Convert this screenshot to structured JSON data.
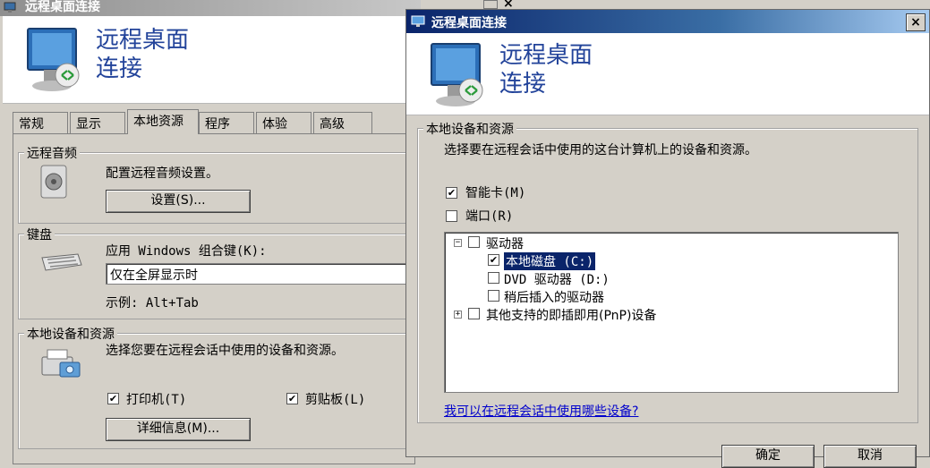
{
  "back_window": {
    "title": "远程桌面连接",
    "banner": {
      "line1": "远程桌面",
      "line2": "连接"
    },
    "tabs": [
      {
        "label": "常规"
      },
      {
        "label": "显示"
      },
      {
        "label": "本地资源"
      },
      {
        "label": "程序"
      },
      {
        "label": "体验"
      },
      {
        "label": "高级"
      }
    ],
    "audio": {
      "group_label": "远程音频",
      "description": "配置远程音频设置。",
      "settings_button": "设置(S)..."
    },
    "keyboard": {
      "group_label": "键盘",
      "apply_label": "应用 Windows 组合键(K):",
      "combo_value": "仅在全屏显示时",
      "example": "示例: Alt+Tab"
    },
    "local": {
      "group_label": "本地设备和资源",
      "description": "选择您要在远程会话中使用的设备和资源。",
      "printer_label": "打印机(T)",
      "printer_checked": true,
      "clipboard_label": "剪贴板(L)",
      "clipboard_checked": true,
      "more_button": "详细信息(M)..."
    }
  },
  "dialog": {
    "title": "远程桌面连接",
    "close_glyph": "×",
    "banner": {
      "line1": "远程桌面",
      "line2": "连接"
    },
    "group_label": "本地设备和资源",
    "description": "选择要在远程会话中使用的这台计算机上的设备和资源。",
    "smart_card": {
      "label": "智能卡(M)",
      "checked": true
    },
    "ports": {
      "label": "端口(R)",
      "checked": false
    },
    "tree": {
      "drives": {
        "label": "驱动器",
        "expander": "−",
        "checked": false,
        "children": [
          {
            "label": "本地磁盘 (C:)",
            "checked": true,
            "selected": true
          },
          {
            "label": "DVD 驱动器 (D:)",
            "checked": false
          },
          {
            "label": "稍后插入的驱动器",
            "checked": false
          }
        ]
      },
      "pnp": {
        "label": "其他支持的即插即用(PnP)设备",
        "expander": "+",
        "checked": false
      }
    },
    "help_link": "我可以在远程会话中使用哪些设备?",
    "ok_button": "确定",
    "cancel_button": "取消"
  },
  "colors": {
    "titlebar_active": "#0a246a",
    "banner_text": "#22439a",
    "link": "#0000cc",
    "face": "#d4d0c8"
  }
}
